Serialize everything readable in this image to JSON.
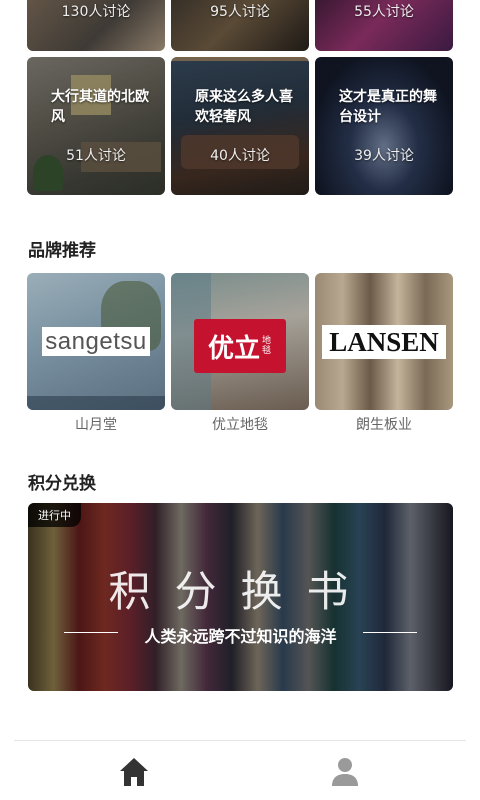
{
  "topics": [
    {
      "title": "",
      "count": "130人讨论"
    },
    {
      "title": "",
      "count": "95人讨论"
    },
    {
      "title": "",
      "count": "55人讨论"
    },
    {
      "title": "大行其道的北欧风",
      "count": "51人讨论"
    },
    {
      "title": "原来这么多人喜欢轻奢风",
      "count": "40人讨论"
    },
    {
      "title": "这才是真正的舞台设计",
      "count": "39人讨论"
    }
  ],
  "brands_section": {
    "title": "品牌推荐",
    "items": [
      {
        "name": "山月堂",
        "logo": "sangetsu"
      },
      {
        "name": "优立地毯",
        "logo": "优立",
        "logo_sub": "地毯"
      },
      {
        "name": "朗生板业",
        "logo": "LANSEN"
      }
    ]
  },
  "points_section": {
    "title": "积分兑换",
    "banner": {
      "badge": "进行中",
      "title": "积分换书",
      "subtitle": "人类永远跨不过知识的海洋"
    }
  },
  "tabbar": {
    "items": [
      {
        "icon": "home-icon",
        "active": true
      },
      {
        "icon": "user-icon",
        "active": false
      }
    ]
  },
  "colors": {
    "accent": "#333333",
    "logo_red": "#c4122f"
  }
}
